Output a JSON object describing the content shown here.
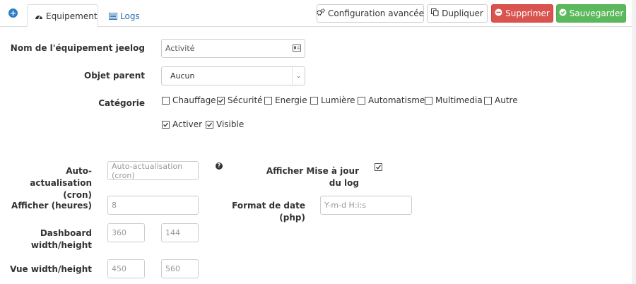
{
  "tabs": {
    "equipment": "Equipement",
    "logs": "Logs"
  },
  "toolbar": {
    "advanced_config": "Configuration avancée",
    "duplicate": "Dupliquer",
    "delete": "Supprimer",
    "save": "Sauvegarder"
  },
  "form": {
    "name_label": "Nom de l'équipement jeelog",
    "name_value": "Activité",
    "parent_label": "Objet parent",
    "parent_value": "Aucun",
    "category_label": "Catégorie",
    "categories": [
      {
        "label": "Chauffage",
        "checked": false
      },
      {
        "label": "Sécurité",
        "checked": true
      },
      {
        "label": "Energie",
        "checked": false
      },
      {
        "label": "Lumière",
        "checked": false
      },
      {
        "label": "Automatisme",
        "checked": false
      },
      {
        "label": "Multimedia",
        "checked": false
      },
      {
        "label": "Autre",
        "checked": false
      }
    ],
    "activate": {
      "label": "Activer",
      "checked": true
    },
    "visible": {
      "label": "Visible",
      "checked": true
    },
    "autorefresh_label_1": "Auto-actualisation",
    "autorefresh_label_2": "(cron)",
    "autorefresh_placeholder": "Auto-actualisation (cron)",
    "show_update_label_1": "Afficher Mise à jour",
    "show_update_label_2": "du log",
    "show_update_checked": true,
    "hours_label": "Afficher (heures)",
    "hours_value": "8",
    "date_format_label": "Format de date (php)",
    "date_format_placeholder": "Y-m-d H:i:s",
    "dashboard_label_1": "Dashboard",
    "dashboard_label_2": "width/height",
    "dashboard_width": "360",
    "dashboard_height": "144",
    "view_label": "Vue width/height",
    "view_width": "450",
    "view_height": "560"
  },
  "colors": {
    "danger": "#d9534f",
    "success": "#5cb85c",
    "link": "#2d6fb5"
  }
}
